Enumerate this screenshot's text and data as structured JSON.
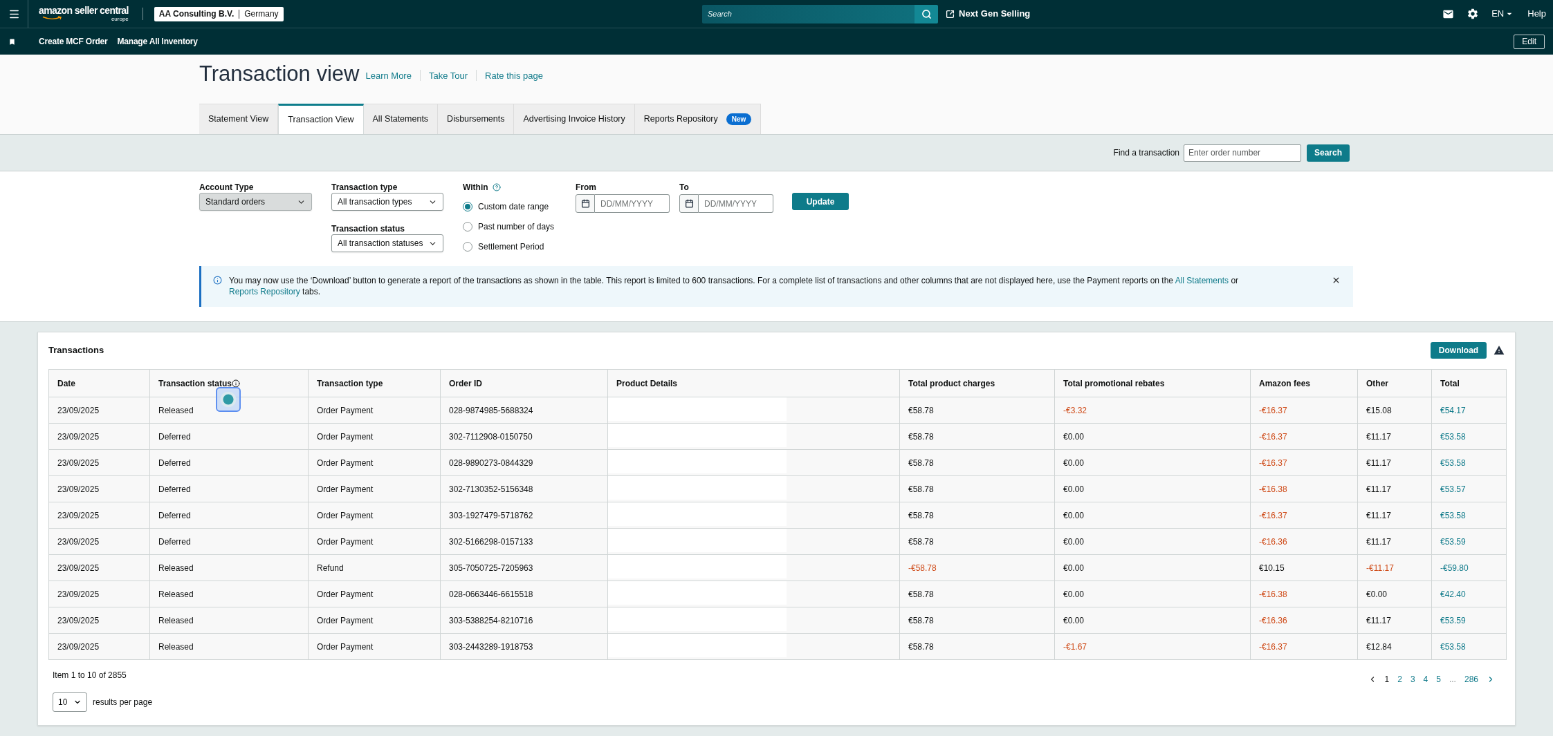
{
  "top_bar": {
    "logo": "amazon seller central",
    "logo_region": "europe",
    "account": "AA Consulting B.V.",
    "marketplace": "Germany",
    "search": {
      "placeholder": "Search"
    },
    "link": "Next Gen Selling",
    "language": "EN",
    "help": "Help"
  },
  "shortcut_bar": {
    "links": [
      "Create MCF Order",
      "Manage All Inventory"
    ],
    "edit": "Edit"
  },
  "header": {
    "title": "Transaction view",
    "links": [
      "Learn More",
      "Take Tour",
      "Rate this page"
    ]
  },
  "tabs": [
    {
      "label": "Statement View",
      "selected": false
    },
    {
      "label": "Transaction View",
      "selected": true
    },
    {
      "label": "All Statements",
      "selected": false
    },
    {
      "label": "Disbursements",
      "selected": false
    },
    {
      "label": "Advertising Invoice History",
      "selected": false
    },
    {
      "label": "Reports Repository",
      "selected": false,
      "badge": "New"
    }
  ],
  "find_transaction": {
    "label": "Find a transaction",
    "placeholder": "Enter order number",
    "button": "Search"
  },
  "filters": {
    "account_type": {
      "label": "Account Type",
      "value": "Standard orders",
      "disabled": true
    },
    "transaction_type": {
      "label": "Transaction type",
      "value": "All transaction types",
      "disabled": false
    },
    "transaction_status": {
      "label": "Transaction status",
      "value": "All transaction statuses",
      "disabled": false
    },
    "within": {
      "label": "Within",
      "options": [
        {
          "label": "Custom date range",
          "selected": true
        },
        {
          "label": "Past number of days",
          "selected": false
        },
        {
          "label": "Settlement Period",
          "selected": false
        }
      ]
    },
    "from": {
      "label": "From",
      "placeholder": "DD/MM/YYYY"
    },
    "to": {
      "label": "To",
      "placeholder": "DD/MM/YYYY"
    },
    "update_button": "Update"
  },
  "notice": {
    "parts": [
      {
        "kind": "text",
        "text": "You may now use the ‘Download’ button to generate a report of the transactions as shown in the table. This report is limited to 600 transactions. For a complete list of transactions and other columns that are not displayed here, use the Payment reports on the "
      },
      {
        "kind": "link",
        "text": "All Statements"
      },
      {
        "kind": "text",
        "text": " or "
      },
      {
        "kind": "link",
        "text": "Reports Repository"
      },
      {
        "kind": "text",
        "text": " tabs."
      }
    ]
  },
  "transactions": {
    "title": "Transactions",
    "download_button": "Download",
    "columns": [
      {
        "label": "Date",
        "info": false
      },
      {
        "label": "Transaction status",
        "info": true
      },
      {
        "label": "Transaction type",
        "info": false
      },
      {
        "label": "Order ID",
        "info": false
      },
      {
        "label": "Product Details",
        "info": false
      },
      {
        "label": "Total product charges",
        "info": false
      },
      {
        "label": "Total promotional rebates",
        "info": false
      },
      {
        "label": "Amazon fees",
        "info": false
      },
      {
        "label": "Other",
        "info": false
      },
      {
        "label": "Total",
        "info": false
      }
    ],
    "rows": [
      {
        "date": "23/09/2025",
        "status": "Released",
        "type": "Order Payment",
        "order_id": "028-9874985-5688324",
        "amounts": [
          {
            "text": "€58.78",
            "negative": false
          },
          {
            "text": "-€3.32",
            "negative": true
          },
          {
            "text": "-€16.37",
            "negative": true
          },
          {
            "text": "€15.08",
            "negative": false
          }
        ],
        "total": "€54.17"
      },
      {
        "date": "23/09/2025",
        "status": "Deferred",
        "type": "Order Payment",
        "order_id": "302-7112908-0150750",
        "amounts": [
          {
            "text": "€58.78",
            "negative": false
          },
          {
            "text": "€0.00",
            "negative": false
          },
          {
            "text": "-€16.37",
            "negative": true
          },
          {
            "text": "€11.17",
            "negative": false
          }
        ],
        "total": "€53.58"
      },
      {
        "date": "23/09/2025",
        "status": "Deferred",
        "type": "Order Payment",
        "order_id": "028-9890273-0844329",
        "amounts": [
          {
            "text": "€58.78",
            "negative": false
          },
          {
            "text": "€0.00",
            "negative": false
          },
          {
            "text": "-€16.37",
            "negative": true
          },
          {
            "text": "€11.17",
            "negative": false
          }
        ],
        "total": "€53.58"
      },
      {
        "date": "23/09/2025",
        "status": "Deferred",
        "type": "Order Payment",
        "order_id": "302-7130352-5156348",
        "amounts": [
          {
            "text": "€58.78",
            "negative": false
          },
          {
            "text": "€0.00",
            "negative": false
          },
          {
            "text": "-€16.38",
            "negative": true
          },
          {
            "text": "€11.17",
            "negative": false
          }
        ],
        "total": "€53.57"
      },
      {
        "date": "23/09/2025",
        "status": "Deferred",
        "type": "Order Payment",
        "order_id": "303-1927479-5718762",
        "amounts": [
          {
            "text": "€58.78",
            "negative": false
          },
          {
            "text": "€0.00",
            "negative": false
          },
          {
            "text": "-€16.37",
            "negative": true
          },
          {
            "text": "€11.17",
            "negative": false
          }
        ],
        "total": "€53.58"
      },
      {
        "date": "23/09/2025",
        "status": "Deferred",
        "type": "Order Payment",
        "order_id": "302-5166298-0157133",
        "amounts": [
          {
            "text": "€58.78",
            "negative": false
          },
          {
            "text": "€0.00",
            "negative": false
          },
          {
            "text": "-€16.36",
            "negative": true
          },
          {
            "text": "€11.17",
            "negative": false
          }
        ],
        "total": "€53.59"
      },
      {
        "date": "23/09/2025",
        "status": "Released",
        "type": "Refund",
        "order_id": "305-7050725-7205963",
        "amounts": [
          {
            "text": "-€58.78",
            "negative": true
          },
          {
            "text": "€0.00",
            "negative": false
          },
          {
            "text": "€10.15",
            "negative": false
          },
          {
            "text": "-€11.17",
            "negative": true
          }
        ],
        "total": "-€59.80"
      },
      {
        "date": "23/09/2025",
        "status": "Released",
        "type": "Order Payment",
        "order_id": "028-0663446-6615518",
        "amounts": [
          {
            "text": "€58.78",
            "negative": false
          },
          {
            "text": "€0.00",
            "negative": false
          },
          {
            "text": "-€16.38",
            "negative": true
          },
          {
            "text": "€0.00",
            "negative": false
          }
        ],
        "total": "€42.40"
      },
      {
        "date": "23/09/2025",
        "status": "Released",
        "type": "Order Payment",
        "order_id": "303-5388254-8210716",
        "amounts": [
          {
            "text": "€58.78",
            "negative": false
          },
          {
            "text": "€0.00",
            "negative": false
          },
          {
            "text": "-€16.36",
            "negative": true
          },
          {
            "text": "€11.17",
            "negative": false
          }
        ],
        "total": "€53.59"
      },
      {
        "date": "23/09/2025",
        "status": "Released",
        "type": "Order Payment",
        "order_id": "303-2443289-1918753",
        "amounts": [
          {
            "text": "€58.78",
            "negative": false
          },
          {
            "text": "-€1.67",
            "negative": true
          },
          {
            "text": "-€16.37",
            "negative": true
          },
          {
            "text": "€12.84",
            "negative": false
          }
        ],
        "total": "€53.58"
      }
    ],
    "summary": "Item 1 to 10 of 2855",
    "pages": [
      {
        "label": "1",
        "kind": "page",
        "selected": true
      },
      {
        "label": "2",
        "kind": "page",
        "selected": false
      },
      {
        "label": "3",
        "kind": "page",
        "selected": false
      },
      {
        "label": "4",
        "kind": "page",
        "selected": false
      },
      {
        "label": "5",
        "kind": "page",
        "selected": false
      },
      {
        "label": "...",
        "kind": "ellipsis",
        "selected": false
      },
      {
        "label": "286",
        "kind": "page",
        "selected": false
      }
    ],
    "per_page": {
      "value": "10",
      "label": "results per page"
    }
  }
}
